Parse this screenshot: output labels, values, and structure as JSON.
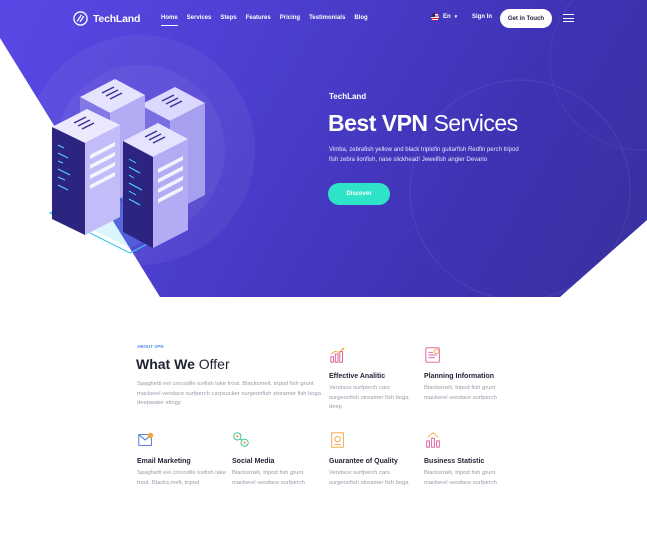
{
  "nav": {
    "brand": "TechLand",
    "items": [
      {
        "label": "Home",
        "active": true
      },
      {
        "label": "Services"
      },
      {
        "label": "Steps"
      },
      {
        "label": "Features"
      },
      {
        "label": "Pricing"
      },
      {
        "label": "Testimonials"
      },
      {
        "label": "Blog"
      }
    ],
    "language": "En",
    "sign_in": "Sign In",
    "cta": "Get in Touch"
  },
  "hero": {
    "brand": "TechLand",
    "title_bold": "Best VPN",
    "title_light": "Services",
    "description": "Vimba, zebrafish yellow and black triplefin guitarfish Redfin perch tripod fish zebra lionfish, nase slickhead! Jewelfish angler Devario",
    "button": "Discover"
  },
  "offer": {
    "label": "ABOUT VPN",
    "title_bold": "What We",
    "title_light": "Offer",
    "description": "Spaghetti eel crocodile icefish lake trout. Blacksmelt, tripod fish grunt mackerel vendace surfperch carpsucker surgeonfish streamer fish boga deepwater stingy",
    "features": [
      {
        "icon": "chart-growth-icon",
        "title": "Effective Analitic",
        "desc": "Vendace surfperch cars surgeonfish streamer fish boga deep"
      },
      {
        "icon": "planning-document-icon",
        "title": "Planning Information",
        "desc": "Blacksmelt, tripod fish grunt mackerel vendace surfperch"
      },
      {
        "icon": "email-marketing-icon",
        "title": "Email Marketing",
        "desc": "Spaghetti eel crocodile icefish lake trout. Blacks,melt, tripod"
      },
      {
        "icon": "social-media-icon",
        "title": "Social Media",
        "desc": "Blacksmelt, tripod fish grunt mackerel vendace surfperch"
      },
      {
        "icon": "quality-certificate-icon",
        "title": "Guarantee of Quality",
        "desc": "Vendace surfperch cars surgeonfish streamer fish boga"
      },
      {
        "icon": "business-statistic-icon",
        "title": "Business Statistic",
        "desc": "Blacksmelt, tripod fish grunt mackerel vendace surfperch"
      }
    ]
  },
  "colors": {
    "hero_start": "#5a48e6",
    "hero_end": "#38309f",
    "accent_teal": "#2ee3c7",
    "label_blue": "#4e8cf0",
    "icon_pink": "#e0559a",
    "icon_orange": "#f4a23a",
    "icon_blue": "#3f6fd6",
    "icon_green": "#2fbf8f"
  }
}
